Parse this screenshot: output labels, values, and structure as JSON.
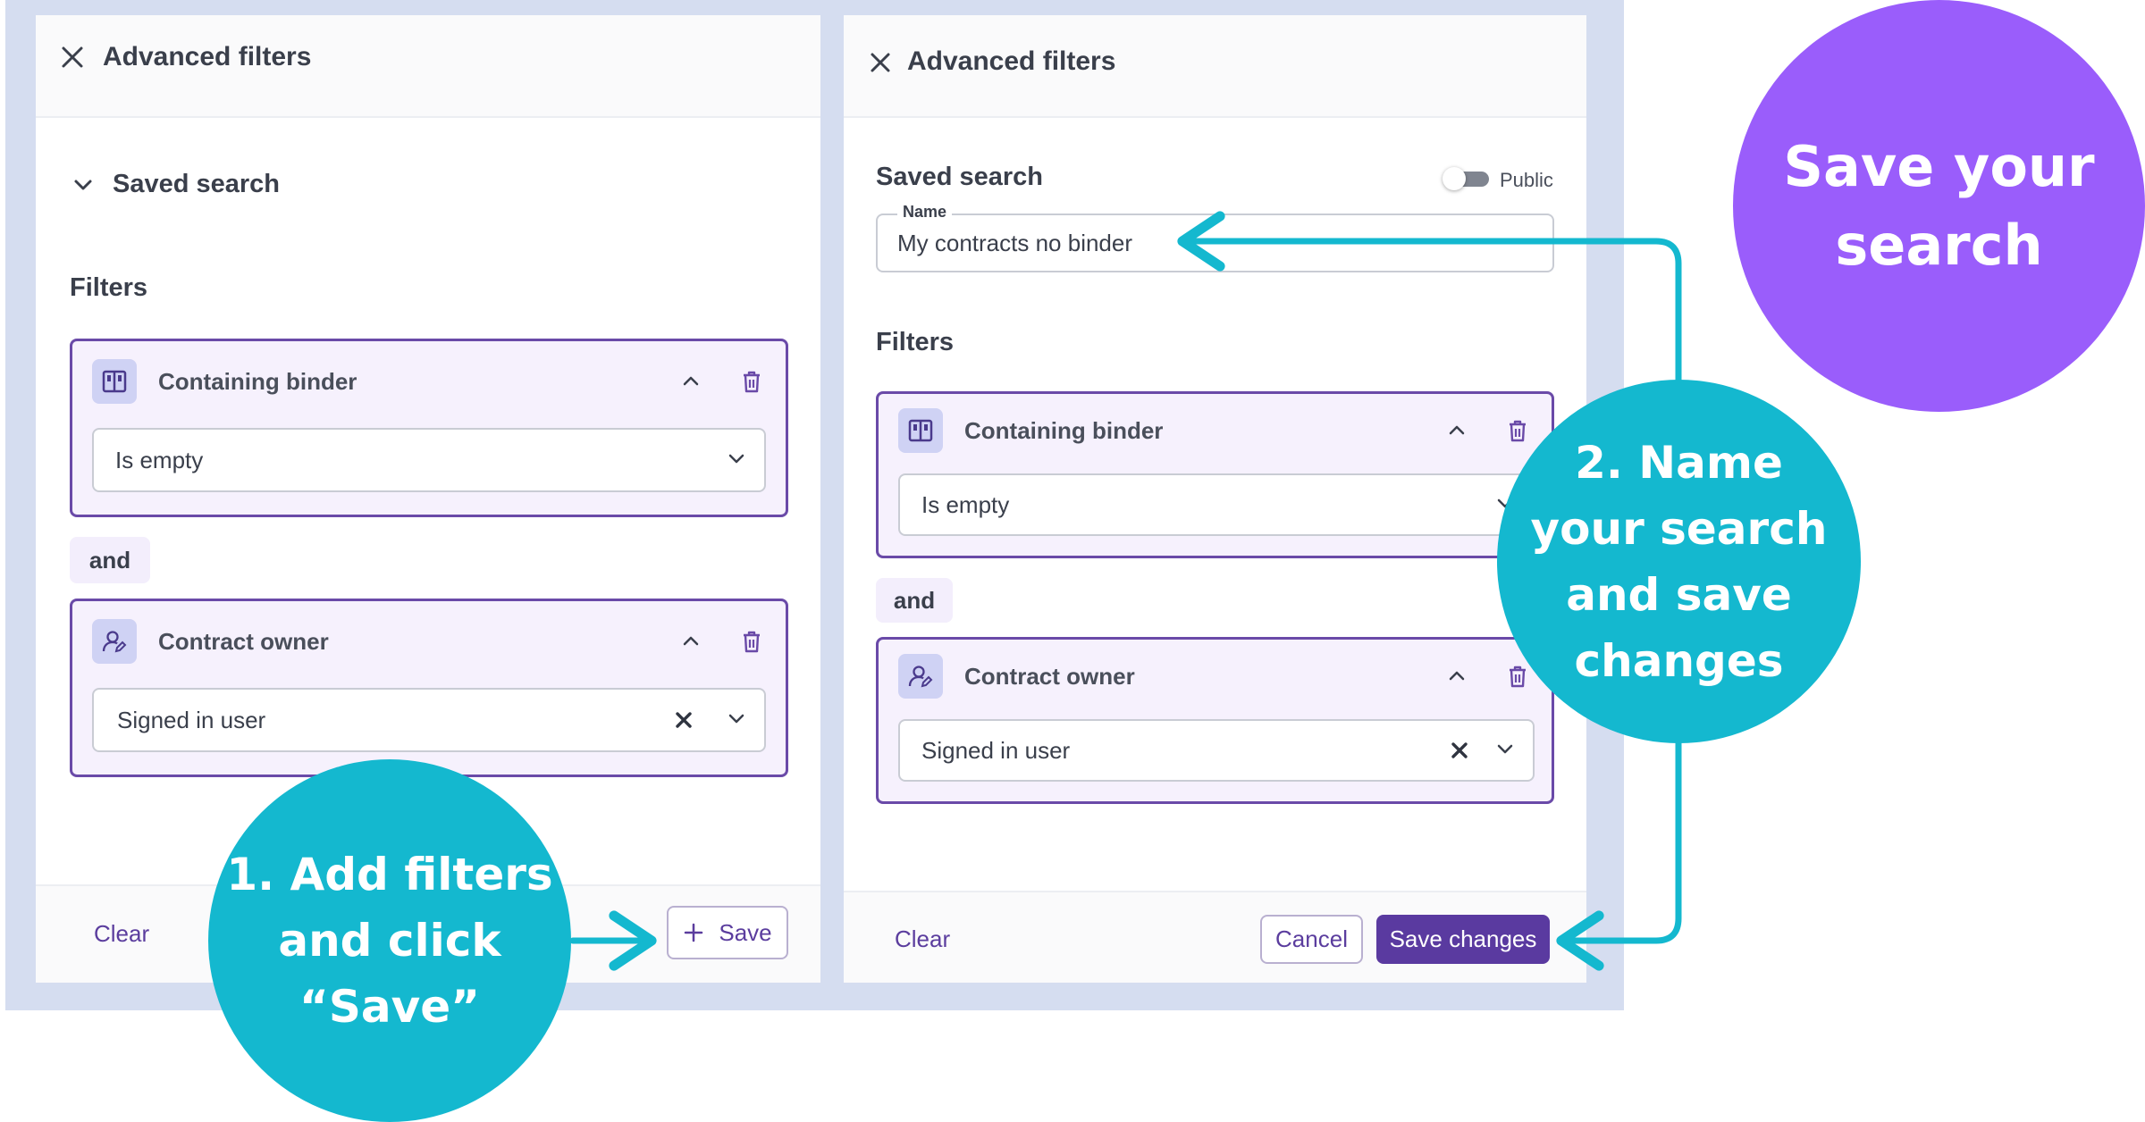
{
  "left_panel": {
    "title": "Advanced filters",
    "saved_search_label": "Saved search",
    "filters_label": "Filters",
    "filter1": {
      "title": "Containing binder",
      "value": "Is empty"
    },
    "and_label": "and",
    "filter2": {
      "title": "Contract owner",
      "value": "Signed in user"
    },
    "clear_label": "Clear",
    "save_label": "Save"
  },
  "right_panel": {
    "title": "Advanced filters",
    "saved_search_label": "Saved search",
    "public_label": "Public",
    "public_enabled": false,
    "name_field": {
      "label": "Name",
      "value": "My contracts no binder"
    },
    "filters_label": "Filters",
    "filter1": {
      "title": "Containing binder",
      "value": "Is empty"
    },
    "and_label": "and",
    "filter2": {
      "title": "Contract owner",
      "value": "Signed in user"
    },
    "clear_label": "Clear",
    "cancel_label": "Cancel",
    "save_changes_label": "Save changes"
  },
  "callouts": {
    "step1": [
      "1. Add filters",
      "and click",
      "“Save”"
    ],
    "step2": [
      "2. Name",
      "your search",
      "and save",
      "changes"
    ],
    "headline": [
      "Save your",
      "search"
    ]
  },
  "colors": {
    "accent": "#5a3aa0",
    "card_border": "#6a4aa8",
    "card_bg": "#f6f1fd",
    "callout_teal": "#14b8cf",
    "callout_purple": "#9a5dfb",
    "backdrop": "#d5ddf0"
  }
}
